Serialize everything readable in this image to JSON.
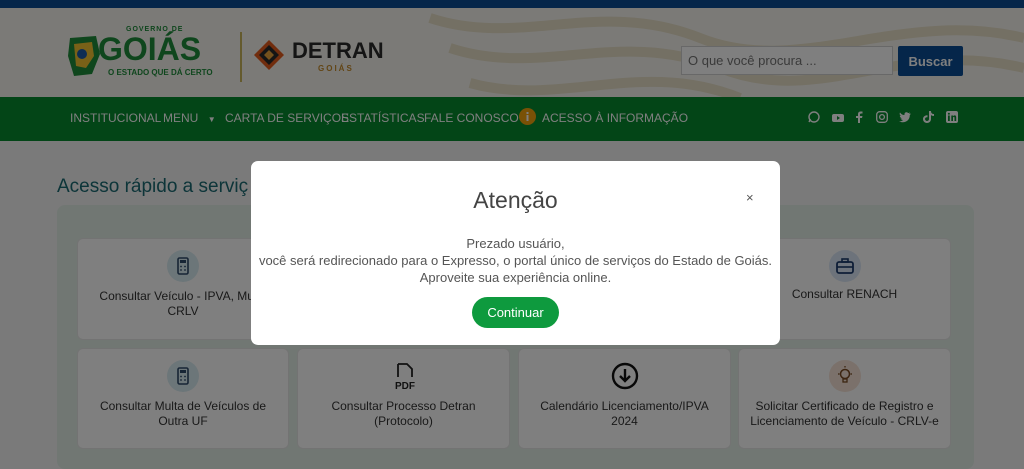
{
  "header": {
    "goias_logo": {
      "top": "GOVERNO DE",
      "name": "GOIÁS",
      "tagline": "O ESTADO QUE DÁ CERTO"
    },
    "detran_logo": {
      "name": "DETRAN",
      "sub": "GOIÁS"
    },
    "search": {
      "placeholder": "O que você procura ...",
      "button": "Buscar"
    }
  },
  "nav": {
    "items": [
      "INSTITUCIONAL",
      "MENU",
      "CARTA DE SERVIÇOS",
      "ESTATÍSTICAS",
      "FALE CONOSCO",
      "ACESSO À INFORMAÇÃO"
    ],
    "social_icons": [
      "whatsapp-icon",
      "youtube-icon",
      "facebook-icon",
      "instagram-icon",
      "twitter-icon",
      "tiktok-icon",
      "linkedin-icon"
    ]
  },
  "main": {
    "section_title": "Acesso rápido a serviç",
    "cards": [
      {
        "label": "Consultar Veículo - IPVA, Multa CRLV",
        "icon": "calculator-icon"
      },
      {
        "label": "Consultar RENACH",
        "icon": "briefcase-icon"
      },
      {
        "label": "Consultar Multa de Veículos de Outra UF",
        "icon": "calculator-icon"
      },
      {
        "label": "Consultar Processo Detran (Protocolo)",
        "icon": "pdf-icon"
      },
      {
        "label": "Calendário Licenciamento/IPVA 2024",
        "icon": "download-icon"
      },
      {
        "label": "Solicitar Certificado de Registro e Licenciamento de Veículo - CRLV-e",
        "icon": "lightbulb-icon"
      }
    ]
  },
  "modal": {
    "title": "Atenção",
    "close": "×",
    "lines": [
      "Prezado usuário,",
      "você será redirecionado para o Expresso, o portal único de serviços do Estado de Goiás.",
      "Aproveite sua experiência online."
    ],
    "button": "Continuar"
  },
  "colors": {
    "nav_green": "#068a2f",
    "brand_blue": "#0b4d94",
    "button_green": "#0e9a3e"
  }
}
